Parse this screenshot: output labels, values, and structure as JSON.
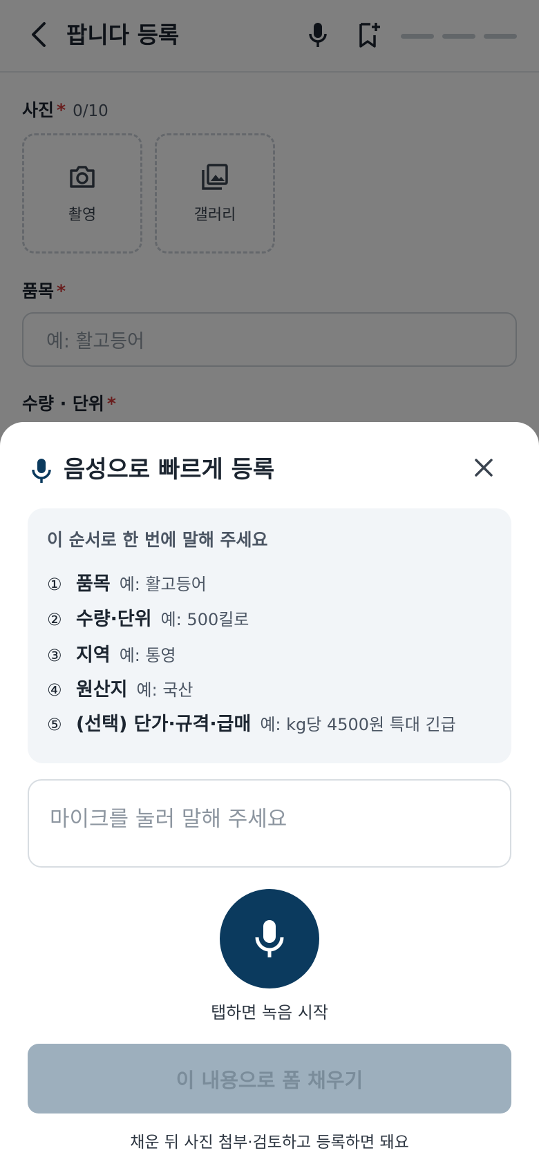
{
  "header": {
    "title": "팝니다 등록",
    "back_icon": "back-arrow-icon",
    "mic_icon": "mic-icon",
    "bookmark_icon": "bookmark-add-icon"
  },
  "form": {
    "photo": {
      "label": "사진",
      "required_mark": "*",
      "count": "0/10",
      "camera_label": "촬영",
      "gallery_label": "갤러리"
    },
    "item": {
      "label": "품목",
      "required_mark": "*",
      "placeholder": "예: 활고등어"
    },
    "quantity": {
      "label": "수량 · 단위",
      "required_mark": "*"
    }
  },
  "sheet": {
    "title": "음성으로 빠르게 등록",
    "guide_heading": "이 순서로 한 번에 말해 주세요",
    "steps": [
      {
        "num": "①",
        "label": "품목",
        "example": "예: 활고등어"
      },
      {
        "num": "②",
        "label": "수량·단위",
        "example": "예: 500킬로"
      },
      {
        "num": "③",
        "label": "지역",
        "example": "예: 통영"
      },
      {
        "num": "④",
        "label": "원산지",
        "example": "예: 국산"
      },
      {
        "num": "⑤",
        "label": "(선택) 단가·규격·급매",
        "example": "예: kg당 4500원 특대 긴급"
      }
    ],
    "input_placeholder": "마이크를 눌러 말해 주세요",
    "record_hint": "탭하면 녹음 시작",
    "fill_button": "이 내용으로 폼 채우기",
    "footer_note": "채운 뒤 사진 첨부·검토하고 등록하면 돼요"
  },
  "colors": {
    "primary": "#0b3a5e",
    "required": "#d23a3a",
    "disabled_button": "#9dafbd",
    "guide_background": "#f2f5f8"
  }
}
